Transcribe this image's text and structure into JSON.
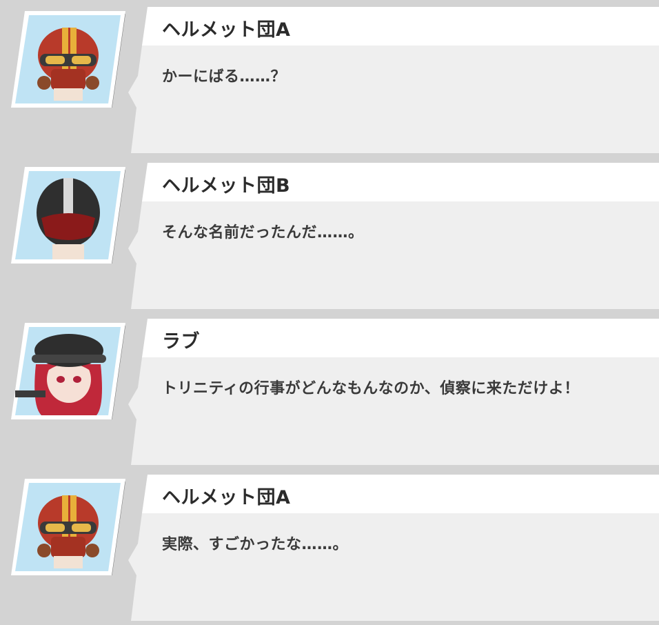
{
  "dialogue": [
    {
      "speaker": "ヘルメット団A",
      "text": "かーにばる……？",
      "portrait": "red-helmet-goggles-gasmask"
    },
    {
      "speaker": "ヘルメット団B",
      "text": "そんな名前だったんだ……。",
      "portrait": "black-white-full-face-helmet"
    },
    {
      "speaker": "ラブ",
      "text": "トリニティの行事がどんなもんなのか、偵察に来ただけよ！",
      "portrait": "red-haired-girl-black-helmet"
    },
    {
      "speaker": "ヘルメット団A",
      "text": "実際、すごかったな……。",
      "portrait": "red-helmet-goggles-gasmask"
    }
  ],
  "colors": {
    "background": "#d3d3d3",
    "bubble": "#efefef",
    "name_bar": "#ffffff",
    "name_text": "#2b2b2b",
    "message_text": "#3a3a3a"
  }
}
